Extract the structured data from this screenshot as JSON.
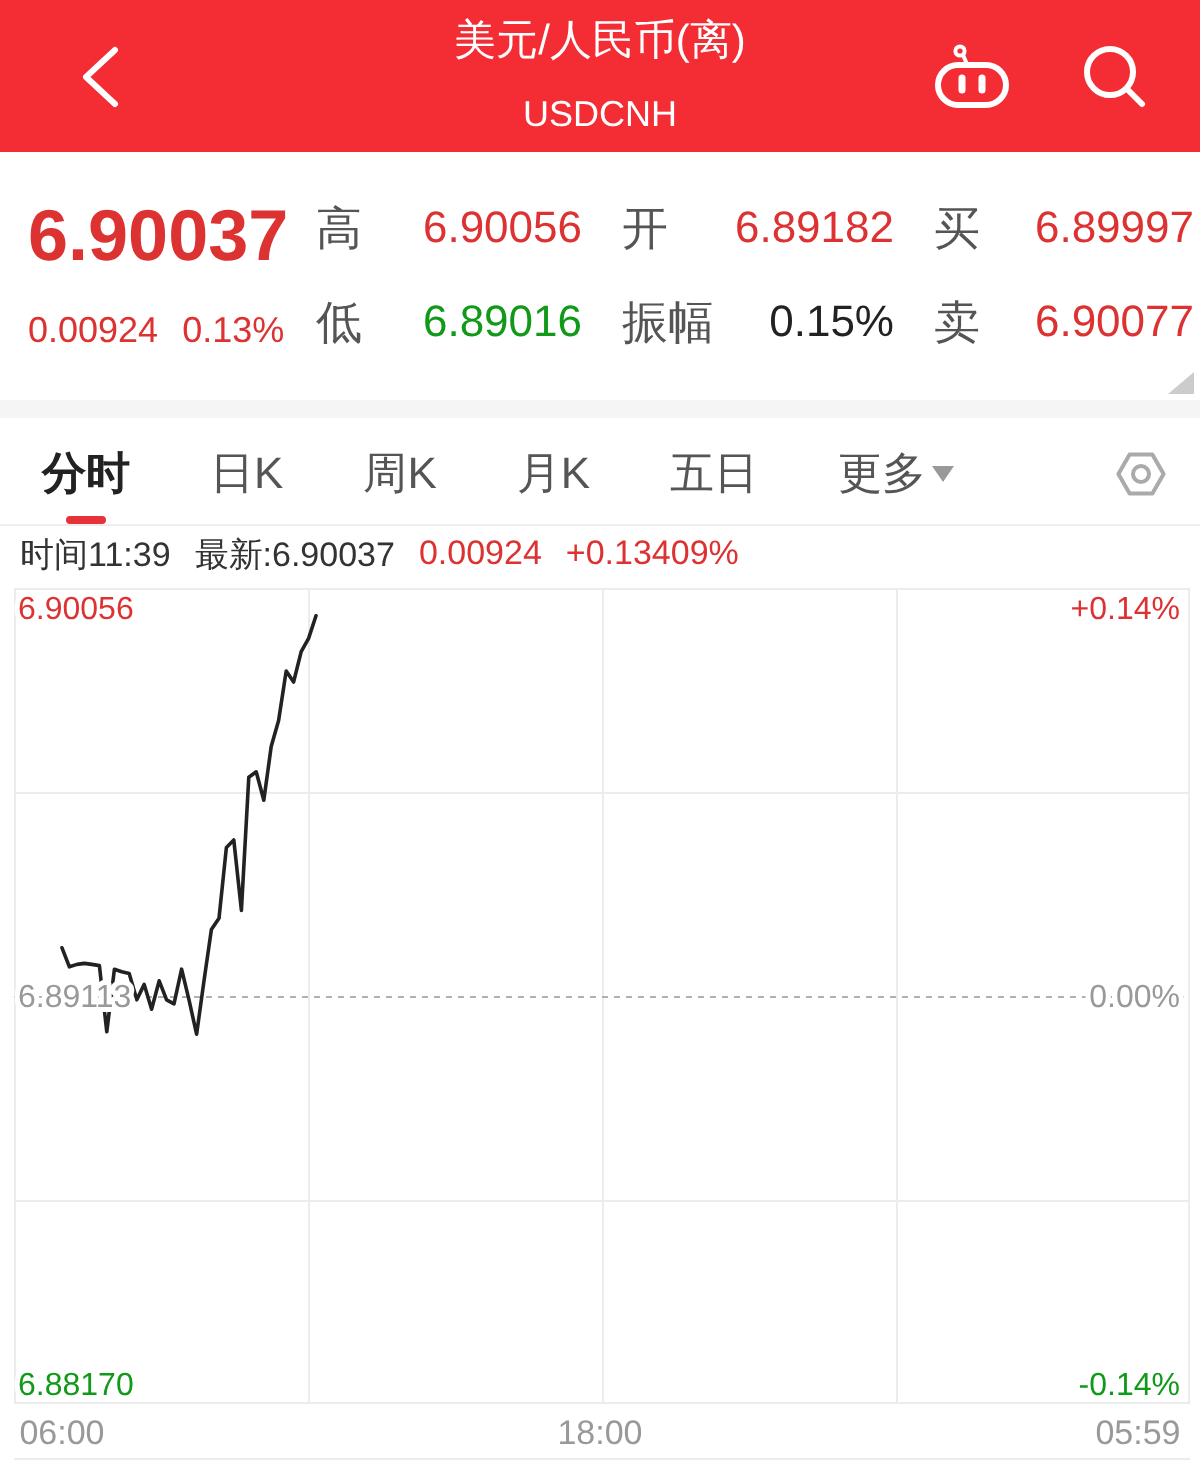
{
  "header": {
    "title": "美元/人民币(离)",
    "subtitle": "USDCNH"
  },
  "quote": {
    "price": "6.90037",
    "change": "0.00924",
    "change_percent": "0.13%",
    "stats": [
      {
        "label": "高",
        "value": "6.90056",
        "color": "#dc3232"
      },
      {
        "label": "开",
        "value": "6.89182",
        "color": "#dc3232"
      },
      {
        "label": "买",
        "value": "6.89997",
        "color": "#dc3232"
      },
      {
        "label": "低",
        "value": "6.89016",
        "color": "#119a19"
      },
      {
        "label": "振幅",
        "value": "0.15%",
        "color": "#222222"
      },
      {
        "label": "卖",
        "value": "6.90077",
        "color": "#dc3232"
      }
    ]
  },
  "tabs": [
    {
      "label": "分时",
      "selected": true,
      "kind": "plain"
    },
    {
      "label": "日K",
      "selected": false,
      "kind": "plain"
    },
    {
      "label": "周K",
      "selected": false,
      "kind": "plain"
    },
    {
      "label": "月K",
      "selected": false,
      "kind": "plain"
    },
    {
      "label": "五日",
      "selected": false,
      "kind": "plain"
    },
    {
      "label": "更多",
      "selected": false,
      "kind": "dropdown"
    }
  ],
  "chart": {
    "info": [
      {
        "text": "时间11:39",
        "color": "#333333"
      },
      {
        "text": "最新:6.90037",
        "color": "#333333"
      },
      {
        "text": "0.00924",
        "color": "#dc3232"
      },
      {
        "text": "+0.13409%",
        "color": "#dc3232"
      }
    ],
    "percent_labels": [
      {
        "text": "+0.14%",
        "color": "#dc3232"
      },
      {
        "text": "0.00%",
        "color": "#999999"
      },
      {
        "text": "-0.14%",
        "color": "#119a19"
      }
    ],
    "chart_data": {
      "type": "line",
      "categories": [
        "06:00",
        null,
        null,
        null,
        null,
        null,
        null,
        null,
        null,
        null,
        null,
        null,
        null,
        null,
        null,
        null,
        null,
        null,
        null,
        null,
        null,
        null,
        null,
        null,
        null,
        null,
        null,
        null,
        null,
        null,
        null,
        null,
        null,
        null,
        null,
        null,
        null,
        null,
        null,
        null,
        null,
        null,
        null,
        null,
        null,
        null,
        null,
        null,
        null,
        null,
        null,
        null,
        null,
        null,
        null,
        null,
        null,
        null,
        null,
        null,
        null,
        null,
        null,
        null,
        null,
        null,
        null,
        null,
        null,
        null,
        null,
        null,
        "18:00",
        null,
        null,
        null,
        null,
        null,
        null,
        null,
        null,
        null,
        null,
        null,
        null,
        null,
        null,
        null,
        null,
        null,
        null,
        null,
        null,
        null,
        null,
        null,
        null,
        null,
        null,
        null,
        null,
        null,
        null,
        null,
        null,
        null,
        null,
        null,
        null,
        null,
        null,
        null,
        null,
        null,
        null,
        null,
        null,
        null,
        null,
        null,
        null,
        null,
        null,
        null,
        null,
        null,
        null,
        null,
        null,
        null,
        null,
        null,
        null,
        null,
        null,
        null,
        null,
        null,
        null,
        null,
        null,
        null,
        null,
        null,
        "05:59"
      ],
      "values": [
        6.8923,
        6.89184,
        6.8919,
        6.89192,
        6.8919,
        6.89187,
        6.89026,
        6.89178,
        6.89172,
        6.89168,
        6.89104,
        6.89141,
        6.89081,
        6.8915,
        6.89104,
        6.89094,
        6.89178,
        6.89104,
        6.8902,
        6.8915,
        6.89275,
        6.89302,
        6.89474,
        6.89492,
        6.89321,
        6.89645,
        6.89658,
        6.89589,
        6.89719,
        6.89783,
        6.89903,
        6.89876,
        6.8995,
        6.89982,
        6.90037,
        null,
        null,
        null,
        null,
        null,
        null,
        null,
        null,
        null,
        null,
        null,
        null,
        null,
        null,
        null,
        null,
        null,
        null,
        null,
        null,
        null,
        null,
        null,
        null,
        null,
        null,
        null,
        null,
        null,
        null,
        null,
        null,
        null,
        null,
        null,
        null,
        null,
        null,
        null,
        null,
        null,
        null,
        null,
        null,
        null,
        null,
        null,
        null,
        null,
        null,
        null,
        null,
        null,
        null,
        null,
        null,
        null,
        null,
        null,
        null,
        null,
        null,
        null,
        null,
        null,
        null,
        null,
        null,
        null,
        null,
        null,
        null,
        null,
        null,
        null,
        null,
        null,
        null,
        null,
        null,
        null,
        null,
        null,
        null,
        null,
        null,
        null,
        null,
        null,
        null,
        null,
        null,
        null,
        null,
        null,
        null,
        null,
        null,
        null,
        null,
        null,
        null,
        null,
        null,
        null,
        null,
        null,
        null,
        null,
        null
      ],
      "ylim": [
        6.8817,
        6.90056
      ],
      "yticks": [
        {
          "value": 6.90056,
          "label": "6.90056"
        },
        {
          "value": 6.89113,
          "label": "6.89113"
        },
        {
          "value": 6.8817,
          "label": "6.88170"
        }
      ],
      "ref_lines": [
        {
          "axis": "y",
          "value": 6.89113
        }
      ]
    }
  }
}
